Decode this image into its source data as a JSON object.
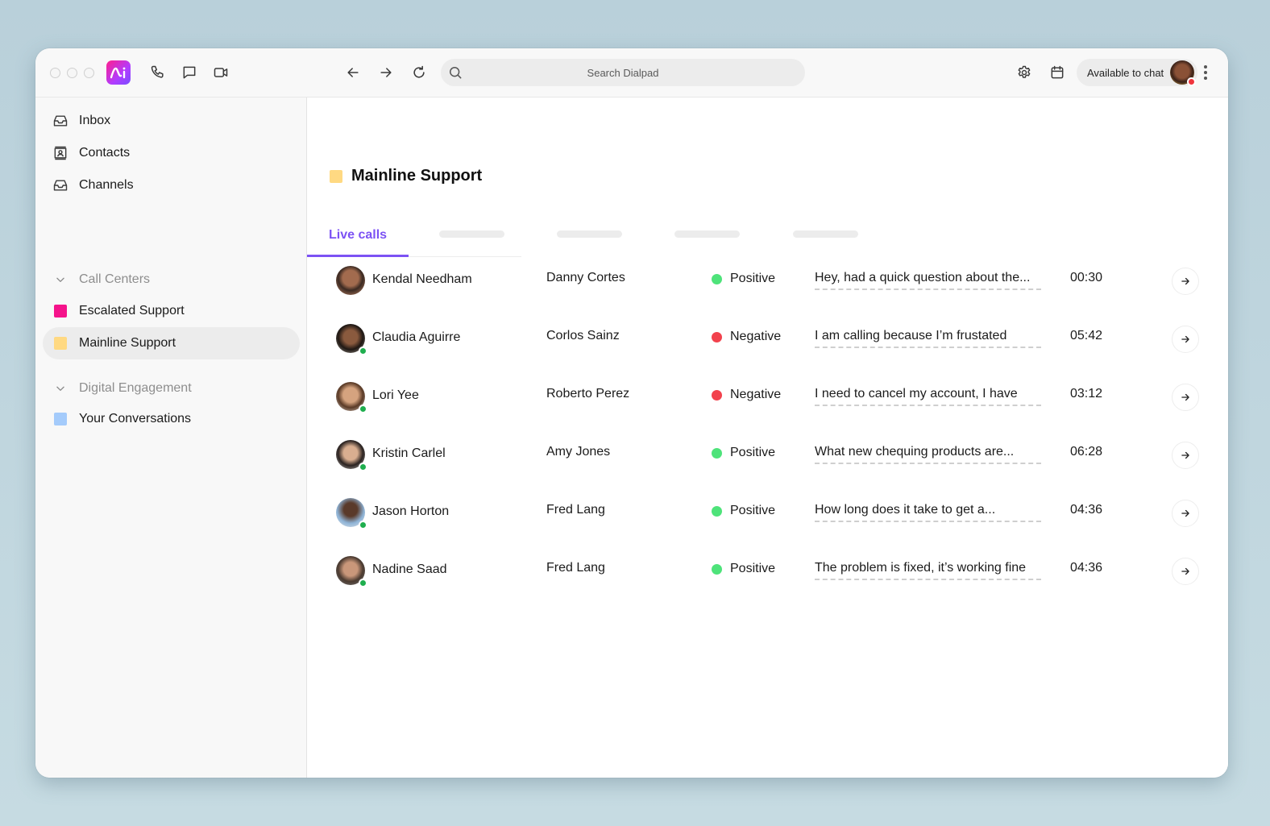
{
  "toolbar": {
    "search_placeholder": "Search Dialpad",
    "status_label": "Available to chat",
    "status_color": "#f0353d",
    "icons": [
      "phone-icon",
      "chat-icon",
      "video-icon",
      "back-arrow-icon",
      "forward-arrow-icon",
      "refresh-icon",
      "search-icon",
      "gear-icon",
      "calendar-icon",
      "more-vertical-icon"
    ]
  },
  "sidebar": {
    "nav": [
      {
        "label": "Inbox",
        "icon": "inbox-icon"
      },
      {
        "label": "Contacts",
        "icon": "contacts-icon"
      },
      {
        "label": "Channels",
        "icon": "channels-icon"
      }
    ],
    "sections": [
      {
        "label": "Call Centers",
        "items": [
          {
            "label": "Escalated Support",
            "color": "#f5138b",
            "selected": false
          },
          {
            "label": "Mainline Support",
            "color": "#ffd982",
            "selected": true
          }
        ]
      },
      {
        "label": "Digital Engagement",
        "items": [
          {
            "label": "Your Conversations",
            "color": "#a4cbfb",
            "selected": false
          }
        ]
      }
    ]
  },
  "main": {
    "title": "Mainline Support",
    "title_color": "#ffd982",
    "tabs": [
      {
        "label": "Live calls",
        "active": true
      }
    ],
    "accent_color": "#7c52f4",
    "calls": [
      {
        "agent": "Kendal Needham",
        "caller": "Danny Cortes",
        "sentiment": "Positive",
        "sentiment_color": "#4ee37a",
        "snippet": "Hey, had a quick question about the...",
        "duration": "00:30",
        "online": false
      },
      {
        "agent": "Claudia Aguirre",
        "caller": "Corlos Sainz",
        "sentiment": "Negative",
        "sentiment_color": "#f2424d",
        "snippet": "I am calling because I’m frustated",
        "duration": "05:42",
        "online": true
      },
      {
        "agent": "Lori Yee",
        "caller": "Roberto Perez",
        "sentiment": "Negative",
        "sentiment_color": "#f2424d",
        "snippet": "I need to cancel my account, I have",
        "duration": "03:12",
        "online": true
      },
      {
        "agent": "Kristin Carlel",
        "caller": "Amy Jones",
        "sentiment": "Positive",
        "sentiment_color": "#4ee37a",
        "snippet": "What new chequing products are...",
        "duration": "06:28",
        "online": true
      },
      {
        "agent": "Jason Horton",
        "caller": "Fred Lang",
        "sentiment": "Positive",
        "sentiment_color": "#4ee37a",
        "snippet": "How long does it take to get a...",
        "duration": "04:36",
        "online": true
      },
      {
        "agent": "Nadine Saad",
        "caller": "Fred Lang",
        "sentiment": "Positive",
        "sentiment_color": "#4ee37a",
        "snippet": "The problem is fixed, it’s working fine",
        "duration": "04:36",
        "online": true
      }
    ]
  }
}
